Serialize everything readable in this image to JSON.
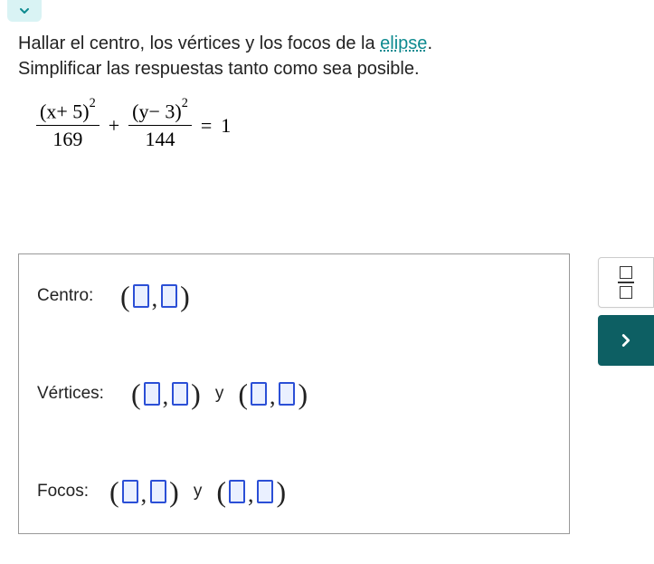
{
  "instruction": {
    "line1_pre": "Hallar el centro, los vértices y los focos de la ",
    "link_text": "elipse",
    "line1_post": ".",
    "line2": "Simplificar las respuestas tanto como sea posible."
  },
  "equation": {
    "term1_num": "(x+ 5)",
    "term1_exp": "2",
    "term1_den": "169",
    "op": "+",
    "term2_num": "(y− 3)",
    "term2_exp": "2",
    "term2_den": "144",
    "eq": "=",
    "rhs": "1"
  },
  "labels": {
    "centro": "Centro:",
    "vertices": "Vértices:",
    "focos": "Focos:",
    "y_sep": "y"
  },
  "parens": {
    "open": "(",
    "close": ")",
    "comma": ","
  },
  "toolbar": {
    "frac": "fraction-tool",
    "next": "next-tool"
  }
}
